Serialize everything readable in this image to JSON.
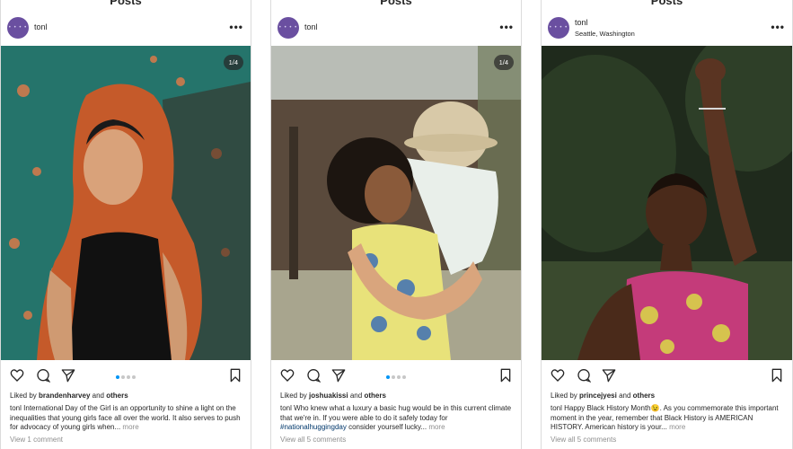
{
  "posts": [
    {
      "top_title": "Posts",
      "username": "tonl",
      "location": "",
      "counter": "1/4",
      "liked_prefix": "Liked by",
      "liked_user": "brandenharvey",
      "liked_and": "and",
      "liked_others": "others",
      "caption_user": "tonl",
      "caption_text": "International Day of the Girl is an opportunity to shine a light on the inequalities that young girls face all over the world. It also serves to push for advocacy of young girls when...",
      "caption_hashtag": "",
      "caption_rest": "",
      "more_label": "more",
      "comments_label": "View 1 comment"
    },
    {
      "top_title": "Posts",
      "username": "tonl",
      "location": "",
      "counter": "1/4",
      "liked_prefix": "Liked by",
      "liked_user": "joshuakissi",
      "liked_and": "and",
      "liked_others": "others",
      "caption_user": "tonl",
      "caption_text": "Who knew what a luxury a basic hug would be in this current climate that we're in. If you were able to do it safely today for",
      "caption_hashtag": "#nationalhuggingday",
      "caption_rest": "consider yourself lucky...",
      "more_label": "more",
      "comments_label": "View all 5 comments"
    },
    {
      "top_title": "Posts",
      "username": "tonl",
      "location": "Seattle, Washington",
      "counter": "",
      "liked_prefix": "Liked by",
      "liked_user": "princejyesi",
      "liked_and": "and",
      "liked_others": "others",
      "caption_user": "tonl",
      "caption_text": "Happy Black History Month😉. As you commemorate this important moment in the year, remember that Black History is AMERICAN HISTORY. American history is your...",
      "caption_hashtag": "",
      "caption_rest": "",
      "more_label": "more",
      "comments_label": "View all 5 comments"
    }
  ],
  "avatar_dots": "• • • •",
  "more_icon": "•••",
  "colors": {
    "link": "#00376b",
    "muted": "#8e8e8e",
    "active_dot": "#0095f6",
    "avatar": "#6a4fa0"
  }
}
